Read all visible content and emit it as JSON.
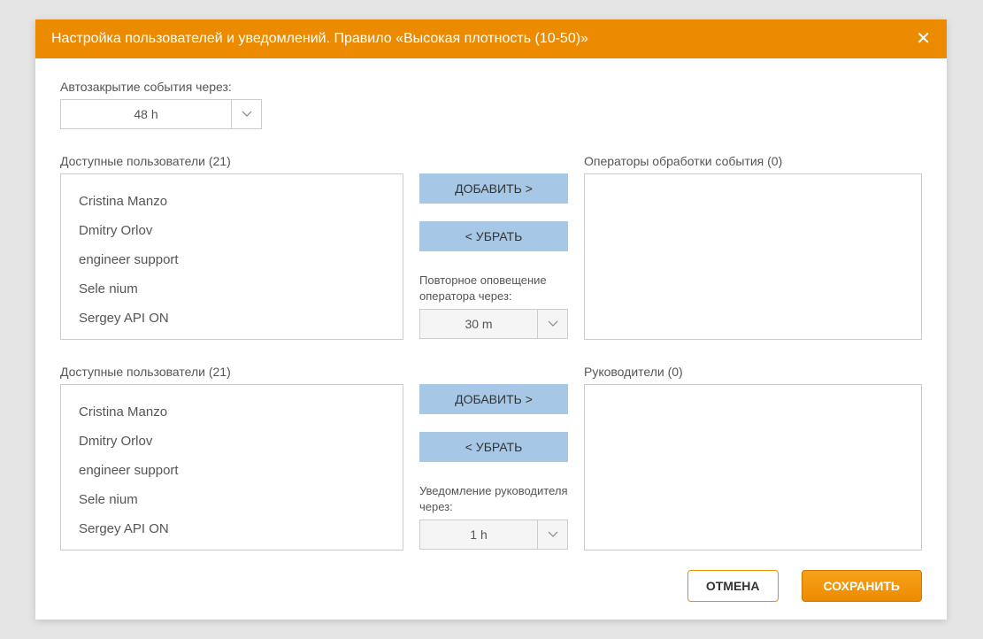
{
  "header": {
    "title": "Настройка пользователей и уведомлений. Правило «Высокая плотность (10-50)»"
  },
  "autoclose": {
    "label": "Автозакрытие события через:",
    "value": "48 h"
  },
  "operators": {
    "available_label": "Доступные пользователи (21)",
    "available_items": [
      "Cristina Manzo",
      "Dmitry Orlov",
      "engineer support",
      "Sele nium",
      "Sergey API ON"
    ],
    "add_button": "ДОБАВИТЬ >",
    "remove_button": "< УБРАТЬ",
    "repeat_label": "Повторное оповещение оператора через:",
    "repeat_value": "30 m",
    "target_label": "Операторы обработки события (0)"
  },
  "supervisors": {
    "available_label": "Доступные пользователи (21)",
    "available_items": [
      "Cristina Manzo",
      "Dmitry Orlov",
      "engineer support",
      "Sele nium",
      "Sergey API ON"
    ],
    "add_button": "ДОБАВИТЬ >",
    "remove_button": "< УБРАТЬ",
    "notify_label": "Уведомление руководителя через:",
    "notify_value": "1 h",
    "target_label": "Руководители (0)"
  },
  "footer": {
    "cancel": "ОТМЕНА",
    "save": "СОХРАНИТЬ"
  }
}
